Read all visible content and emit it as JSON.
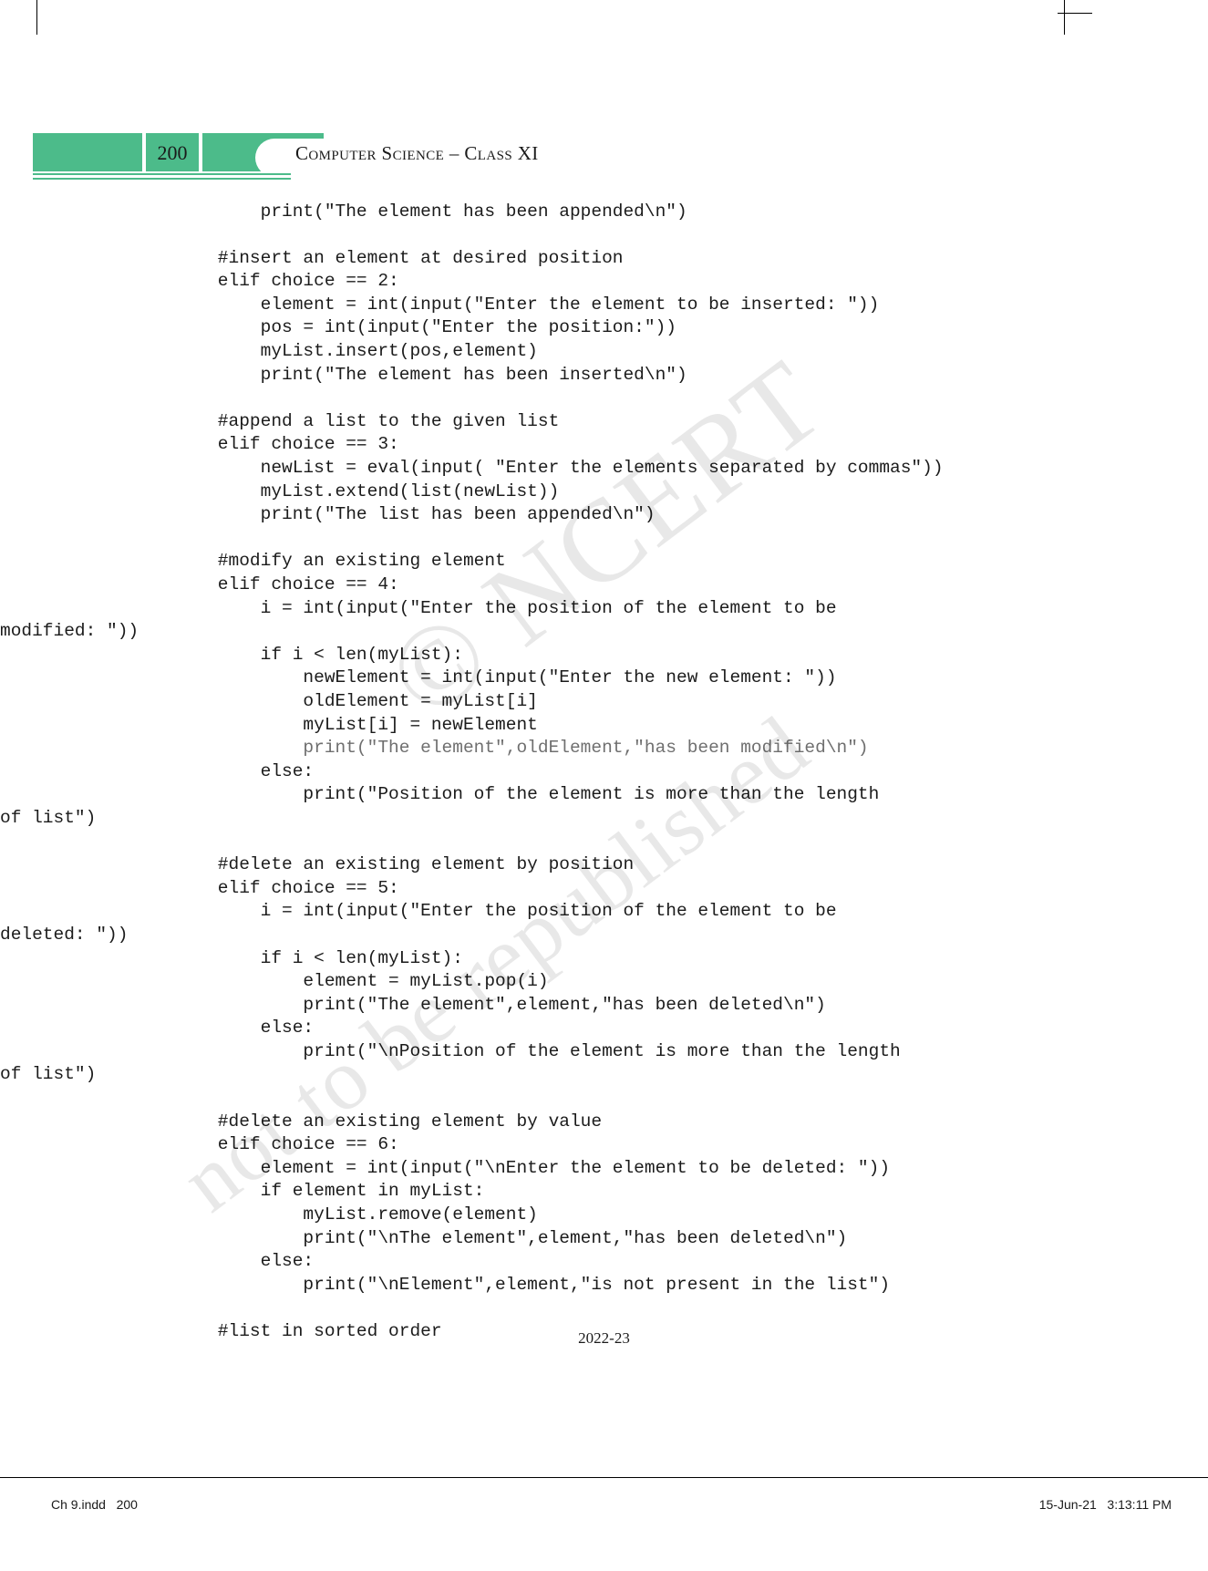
{
  "header": {
    "page_number": "200",
    "title": "Computer Science – Class XI"
  },
  "watermark": {
    "line1": "© NCERT",
    "line2": "not to be republished"
  },
  "code": {
    "lines": [
      {
        "t": "        print(\"The element has been appended\\n\")",
        "style": "normal"
      },
      {
        "t": "",
        "style": "blank"
      },
      {
        "t": "    #insert an element at desired position",
        "style": "normal"
      },
      {
        "t": "    elif choice == 2:",
        "style": "normal"
      },
      {
        "t": "        element = int(input(\"Enter the element to be inserted: \"))",
        "style": "normal"
      },
      {
        "t": "        pos = int(input(\"Enter the position:\"))",
        "style": "normal"
      },
      {
        "t": "        myList.insert(pos,element)",
        "style": "normal"
      },
      {
        "t": "        print(\"The element has been inserted\\n\")",
        "style": "normal"
      },
      {
        "t": "",
        "style": "blank"
      },
      {
        "t": "    #append a list to the given list",
        "style": "normal"
      },
      {
        "t": "    elif choice == 3:",
        "style": "normal"
      },
      {
        "t": "        newList = eval(input( \"Enter the elements separated by commas\"))",
        "style": "normal"
      },
      {
        "t": "        myList.extend(list(newList))",
        "style": "normal"
      },
      {
        "t": "        print(\"The list has been appended\\n\")",
        "style": "normal"
      },
      {
        "t": "",
        "style": "blank"
      },
      {
        "t": "    #modify an existing element",
        "style": "normal"
      },
      {
        "t": "    elif choice == 4:",
        "style": "normal"
      },
      {
        "t": "        i = int(input(\"Enter the position of the element to be",
        "style": "normal"
      },
      {
        "t": "modified: \"))",
        "style": "outdent"
      },
      {
        "t": "        if i < len(myList):",
        "style": "normal"
      },
      {
        "t": "            newElement = int(input(\"Enter the new element: \"))",
        "style": "normal"
      },
      {
        "t": "            oldElement = myList[i]",
        "style": "normal"
      },
      {
        "t": "            myList[i] = newElement",
        "style": "normal"
      },
      {
        "t": "            print(\"The element\",oldElement,\"has been modified\\n\")",
        "style": "faded"
      },
      {
        "t": "        else:",
        "style": "normal"
      },
      {
        "t": "            print(\"Position of the element is more than the length",
        "style": "normal"
      },
      {
        "t": "of list\")",
        "style": "outdent"
      },
      {
        "t": "",
        "style": "blank"
      },
      {
        "t": "    #delete an existing element by position",
        "style": "normal"
      },
      {
        "t": "    elif choice == 5:",
        "style": "normal"
      },
      {
        "t": "        i = int(input(\"Enter the position of the element to be",
        "style": "normal"
      },
      {
        "t": "deleted: \"))",
        "style": "outdent"
      },
      {
        "t": "        if i < len(myList):",
        "style": "normal"
      },
      {
        "t": "            element = myList.pop(i)",
        "style": "normal"
      },
      {
        "t": "            print(\"The element\",element,\"has been deleted\\n\")",
        "style": "normal"
      },
      {
        "t": "        else:",
        "style": "normal"
      },
      {
        "t": "            print(\"\\nPosition of the element is more than the length",
        "style": "normal"
      },
      {
        "t": "of list\")",
        "style": "outdent"
      },
      {
        "t": "",
        "style": "blank"
      },
      {
        "t": "    #delete an existing element by value",
        "style": "normal"
      },
      {
        "t": "    elif choice == 6:",
        "style": "normal"
      },
      {
        "t": "        element = int(input(\"\\nEnter the element to be deleted: \"))",
        "style": "normal"
      },
      {
        "t": "        if element in myList:",
        "style": "normal"
      },
      {
        "t": "            myList.remove(element)",
        "style": "normal"
      },
      {
        "t": "            print(\"\\nThe element\",element,\"has been deleted\\n\")",
        "style": "normal"
      },
      {
        "t": "        else:",
        "style": "normal"
      },
      {
        "t": "            print(\"\\nElement\",element,\"is not present in the list\")",
        "style": "normal"
      },
      {
        "t": "",
        "style": "blank"
      },
      {
        "t": "    #list in sorted order",
        "style": "normal"
      }
    ]
  },
  "footer": {
    "year": "2022-23",
    "file_info": "Ch 9.indd   200",
    "timestamp": "15-Jun-21   3:13:11 PM"
  },
  "colors": {
    "accent_green": "#4cbb8a",
    "text": "#1b1b1b",
    "faded_text": "#6f6f6f"
  }
}
